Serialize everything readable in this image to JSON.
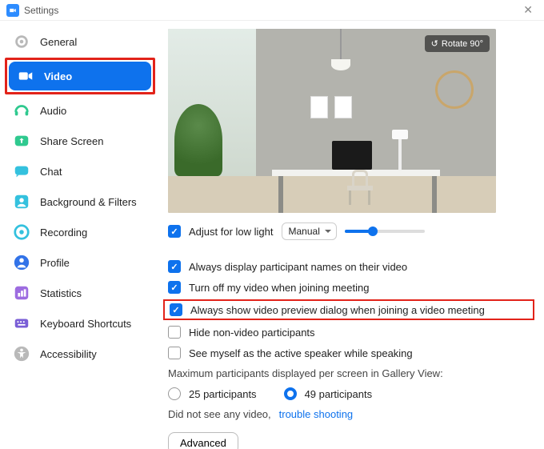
{
  "window": {
    "title": "Settings"
  },
  "sidebar": {
    "items": [
      {
        "label": "General"
      },
      {
        "label": "Video"
      },
      {
        "label": "Audio"
      },
      {
        "label": "Share Screen"
      },
      {
        "label": "Chat"
      },
      {
        "label": "Background & Filters"
      },
      {
        "label": "Recording"
      },
      {
        "label": "Profile"
      },
      {
        "label": "Statistics"
      },
      {
        "label": "Keyboard Shortcuts"
      },
      {
        "label": "Accessibility"
      }
    ]
  },
  "video": {
    "rotate_label": "Rotate 90°",
    "adjust_low_light": "Adjust for low light",
    "low_light_mode": "Manual",
    "options": {
      "display_names": "Always display participant names on their video",
      "turn_off_video": "Turn off my video when joining meeting",
      "preview_dialog": "Always show video preview dialog when joining a video meeting",
      "hide_nonvideo": "Hide non-video participants",
      "see_myself_active": "See myself as the active speaker while speaking"
    },
    "gallery_label": "Maximum participants displayed per screen in Gallery View:",
    "gallery_25": "25 participants",
    "gallery_49": "49 participants",
    "no_video_text": "Did not see any video,",
    "trouble_link": "trouble shooting",
    "advanced": "Advanced"
  }
}
